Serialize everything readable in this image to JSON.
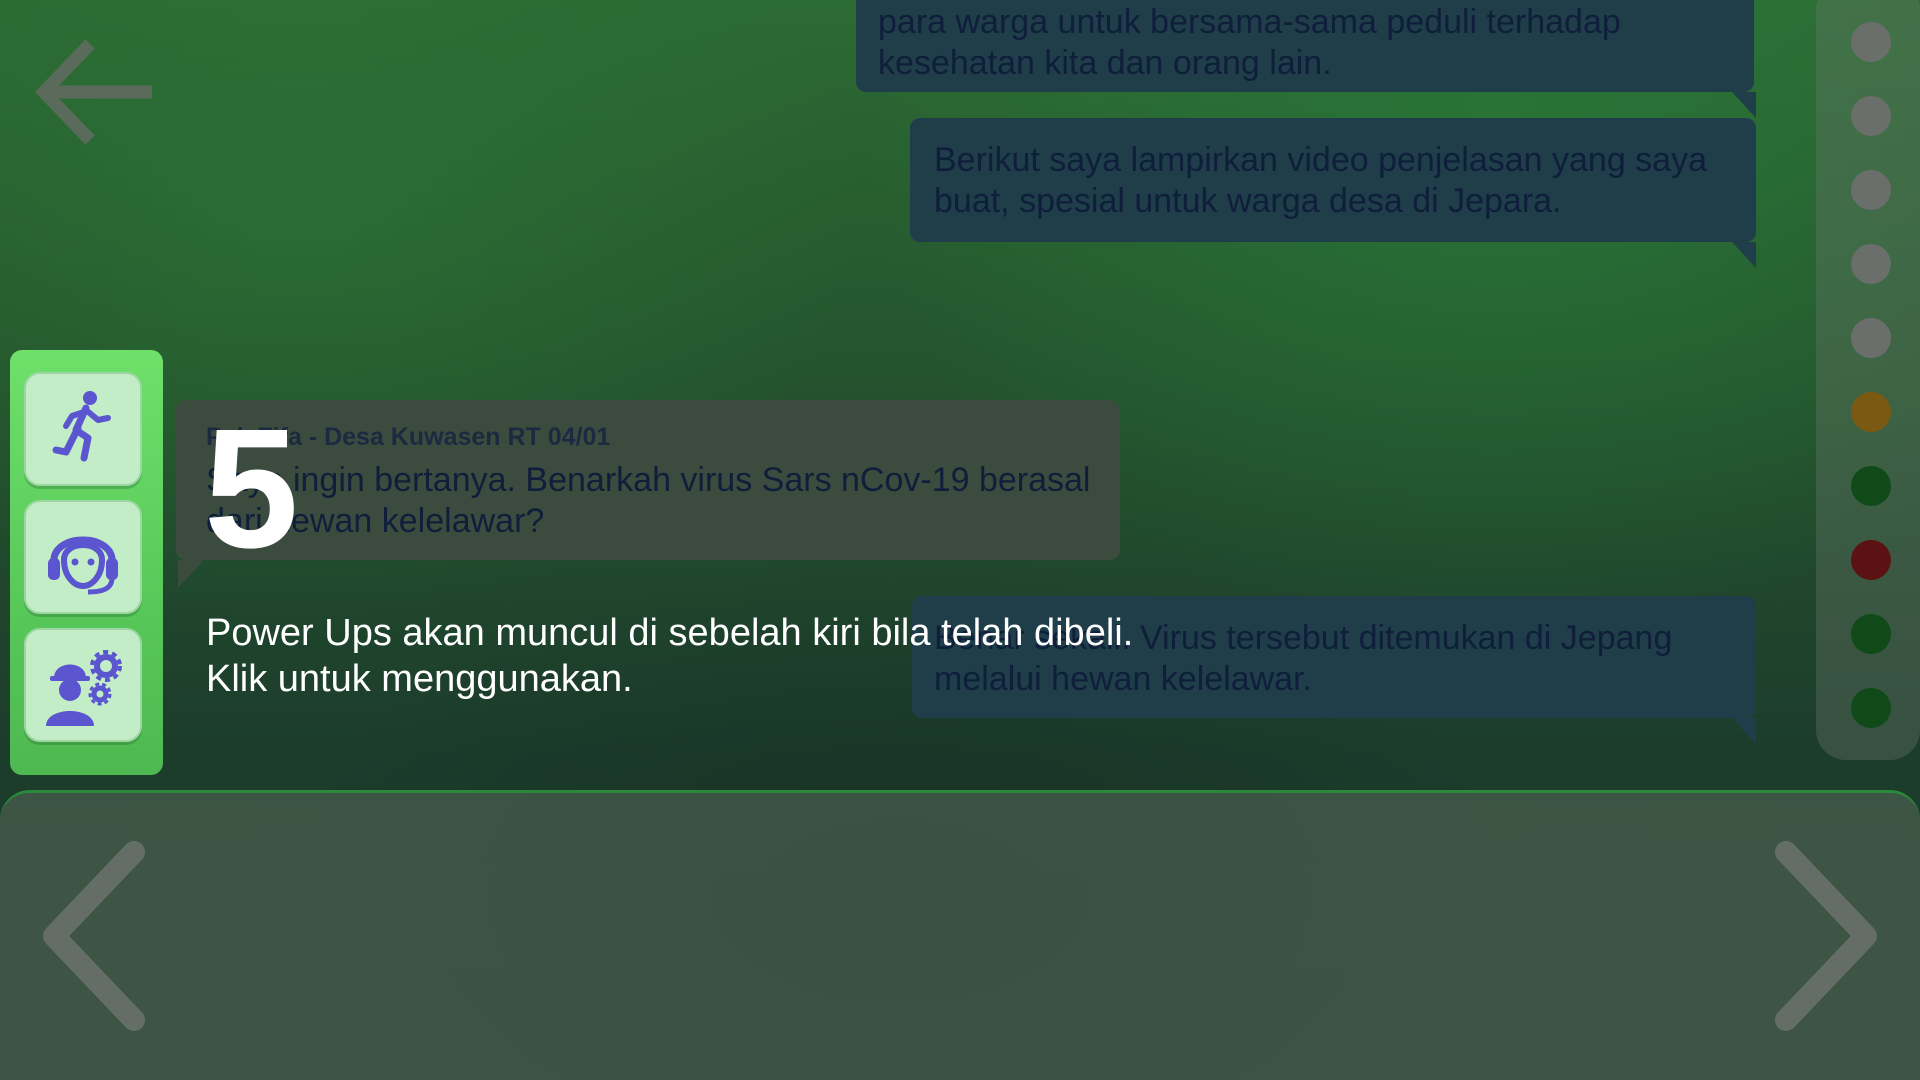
{
  "messages": [
    {
      "side": "right",
      "text": "para warga untuk bersama-sama peduli terhadap\nkesehatan kita dan orang lain."
    },
    {
      "side": "right",
      "text": "Berikut saya lampirkan video penjelasan yang saya\nbuat, spesial untuk warga desa di Jepara."
    },
    {
      "side": "left",
      "sender": "Pak Fifa - Desa Kuwasen RT 04/01",
      "text": "Saya ingin bertanya. Benarkah virus Sars nCov-19 berasal\ndari hewan kelelawar?"
    },
    {
      "side": "right",
      "text": "Benar sekali. Virus tersebut ditemukan di Jepang\nmelalui hewan kelelawar."
    }
  ],
  "progress_dots": [
    {
      "state": "pending",
      "color": "#6b6f6b"
    },
    {
      "state": "pending",
      "color": "#6b6f6b"
    },
    {
      "state": "pending",
      "color": "#6b6f6b"
    },
    {
      "state": "pending",
      "color": "#6b6f6b"
    },
    {
      "state": "pending",
      "color": "#6b6f6b"
    },
    {
      "state": "neutral",
      "color": "#7a5a12"
    },
    {
      "state": "correct",
      "color": "#0f4a18"
    },
    {
      "state": "wrong",
      "color": "#5c1212"
    },
    {
      "state": "correct",
      "color": "#0f4a18"
    },
    {
      "state": "correct",
      "color": "#0f4a18"
    }
  ],
  "powerups": [
    {
      "name": "running-person-icon"
    },
    {
      "name": "customer-service-icon"
    },
    {
      "name": "expert-worker-icon"
    }
  ],
  "tutorial": {
    "step": "5",
    "line1": "Power Ups akan muncul di sebelah kiri bila telah dibeli.",
    "line2": "Klik untuk menggunakan."
  },
  "colors": {
    "accent_green": "#58c85a",
    "icon_purple": "#5b55cf",
    "bubble_blue": "#1f3e49",
    "bubble_gray": "#3b4c3e"
  }
}
